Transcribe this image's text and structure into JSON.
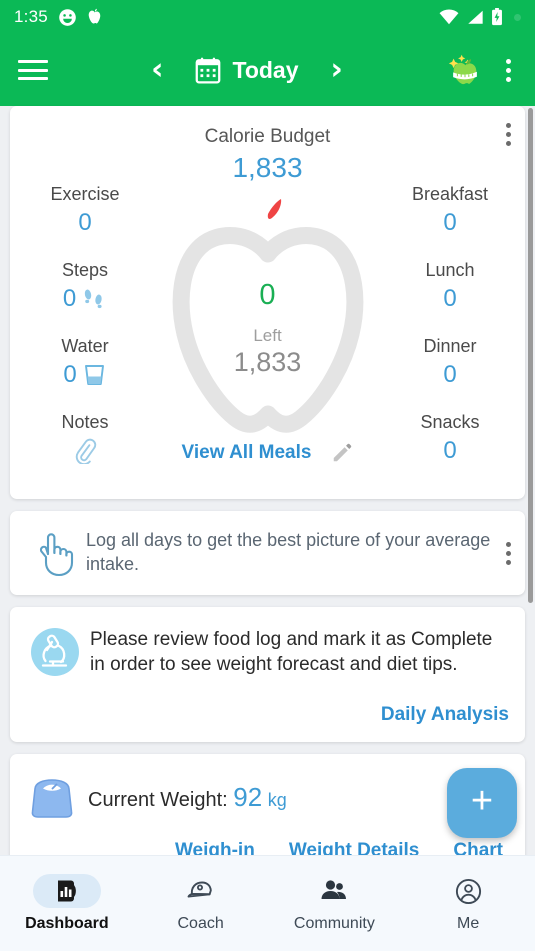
{
  "statusbar": {
    "time": "1:35",
    "icons": [
      "smiley-face-icon",
      "apple-notification-icon",
      "wifi-icon",
      "cell-signal-icon",
      "battery-charging-icon"
    ]
  },
  "toolbar": {
    "menu_label": "menu-icon",
    "prev_label": "‹",
    "next_label": "›",
    "date_label": "Today",
    "calendar_icon": "calendar-icon",
    "app_logo": "apple-tape-logo-icon",
    "overflow": "overflow-menu-icon"
  },
  "calorie_card": {
    "title": "Calorie Budget",
    "budget": "1,833",
    "center": {
      "eaten": "0",
      "left_label": "Left",
      "left_value": "1,833"
    },
    "left_stats": [
      {
        "label": "Exercise",
        "value": "0",
        "icon": ""
      },
      {
        "label": "Steps",
        "value": "0",
        "icon": "footprints-icon"
      },
      {
        "label": "Water",
        "value": "0",
        "icon": "water-glass-icon"
      },
      {
        "label": "Notes",
        "value": "",
        "icon": "paperclip-icon"
      }
    ],
    "right_stats": [
      {
        "label": "Breakfast",
        "value": "0"
      },
      {
        "label": "Lunch",
        "value": "0"
      },
      {
        "label": "Dinner",
        "value": "0"
      },
      {
        "label": "Snacks",
        "value": "0"
      }
    ],
    "view_all_meals": "View All Meals",
    "edit_icon": "pencil-edit-icon"
  },
  "tip_card": {
    "icon": "pointing-hand-icon",
    "text": "Log all days to get the best picture of your average intake."
  },
  "analysis_card": {
    "icon": "microscope-icon",
    "text": "Please review food log and mark it as Complete in order to see weight forecast and diet tips.",
    "link": "Daily Analysis"
  },
  "weight_card": {
    "icon": "bathroom-scale-icon",
    "label": "Current Weight:",
    "value": "92",
    "unit": "kg",
    "links": [
      "Weigh-in",
      "Weight Details",
      "Chart"
    ]
  },
  "fab": {
    "label": "+",
    "icon": "plus-icon"
  },
  "bottomnav": {
    "items": [
      {
        "label": "Dashboard",
        "icon": "dashboard-chart-icon",
        "active": true
      },
      {
        "label": "Coach",
        "icon": "coach-cap-icon",
        "active": false
      },
      {
        "label": "Community",
        "icon": "people-icon",
        "active": false
      },
      {
        "label": "Me",
        "icon": "account-circle-icon",
        "active": false
      }
    ]
  },
  "colors": {
    "brand_green": "#0bb956",
    "accent_blue": "#3e9bd4",
    "link_blue": "#2f8fd0",
    "eaten_green": "#1aaf54",
    "apple_outline": "#e4e4e4",
    "stem_red": "#ef4444"
  }
}
